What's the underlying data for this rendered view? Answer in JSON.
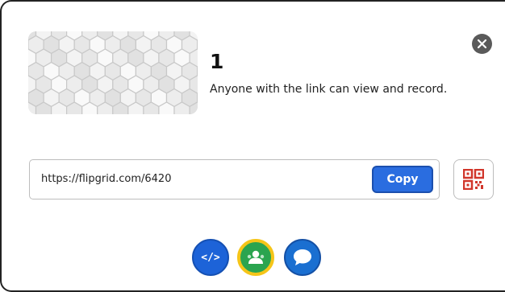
{
  "card": {
    "title": "1",
    "subtitle": "Anyone with the link can view and record."
  },
  "link": {
    "url": "https://flipgrid.com/6420",
    "copy_label": "Copy"
  },
  "icons": {
    "close": "close-icon",
    "qr": "qr-code-icon",
    "embed": "embed-code-icon",
    "classroom": "google-classroom-icon",
    "remind": "remind-chat-icon"
  },
  "share": {
    "embed_label": "</>"
  },
  "colors": {
    "accent": "#2a6de0",
    "classroom_green": "#2aa44f",
    "classroom_ring": "#f5c518"
  }
}
